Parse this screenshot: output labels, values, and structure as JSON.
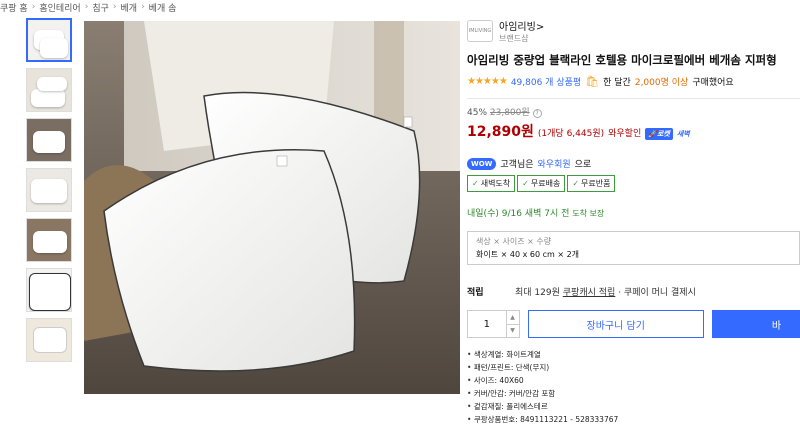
{
  "breadcrumb": [
    "쿠팡 홈",
    "홈인테리어",
    "침구",
    "베개",
    "베개 솜"
  ],
  "thumbnails_count": 7,
  "brand": {
    "name": "아임리빙",
    "chevron": ">",
    "sub": "브랜드샵",
    "logo_text": "IMLIVING"
  },
  "product": {
    "title": "아임리빙 중량업 블랙라인 호텔용 마이크로필에버 베개솜 지퍼형",
    "stars": "★★★★★",
    "rating_value": 4.5,
    "review_count": "49,806 개 상품평",
    "purchase_prefix": "한 달간",
    "purchase_count": "2,000명 이상",
    "purchase_suffix": "구매했어요"
  },
  "price": {
    "discount": "45%",
    "original": "23,800원",
    "final": "12,890원",
    "unit_price": "(1개당 6,445원)",
    "wow_sale": "와우할인",
    "rocket_badge": "🚀로켓",
    "rocket_sub": "새벽"
  },
  "wow": {
    "badge": "WOW",
    "text_prefix": "고객님은",
    "link": "와우회원",
    "text_suffix": "으로",
    "benefits": [
      "새벽도착",
      "무료배송",
      "무료반품"
    ]
  },
  "delivery": {
    "text": "내일(수) 9/16 새벽 7시 전",
    "note": "도착 보장"
  },
  "option": {
    "label": "색상 × 사이즈 × 수량",
    "value": "화이트 × 40 x 60 cm × 2개"
  },
  "points": {
    "label": "적립",
    "prefix": "최대 129원",
    "link": "쿠팡캐시 적립",
    "suffix": "· 쿠페이 머니 결제시"
  },
  "buy": {
    "quantity": "1",
    "cart_label": "장바구니 담기",
    "buy_label": "바"
  },
  "specs": [
    "색상계열: 화이트계열",
    "패턴/프린트: 단색(무지)",
    "사이즈: 40X60",
    "커버/안감: 커버/안감 포함",
    "겉감재질: 폴리에스테르",
    "쿠팡상품번호: 8491113221 - 528333767"
  ],
  "colors": {
    "accent": "#346aff",
    "price": "#ae0000",
    "green": "#3e9b3e",
    "star": "#f5a623"
  }
}
